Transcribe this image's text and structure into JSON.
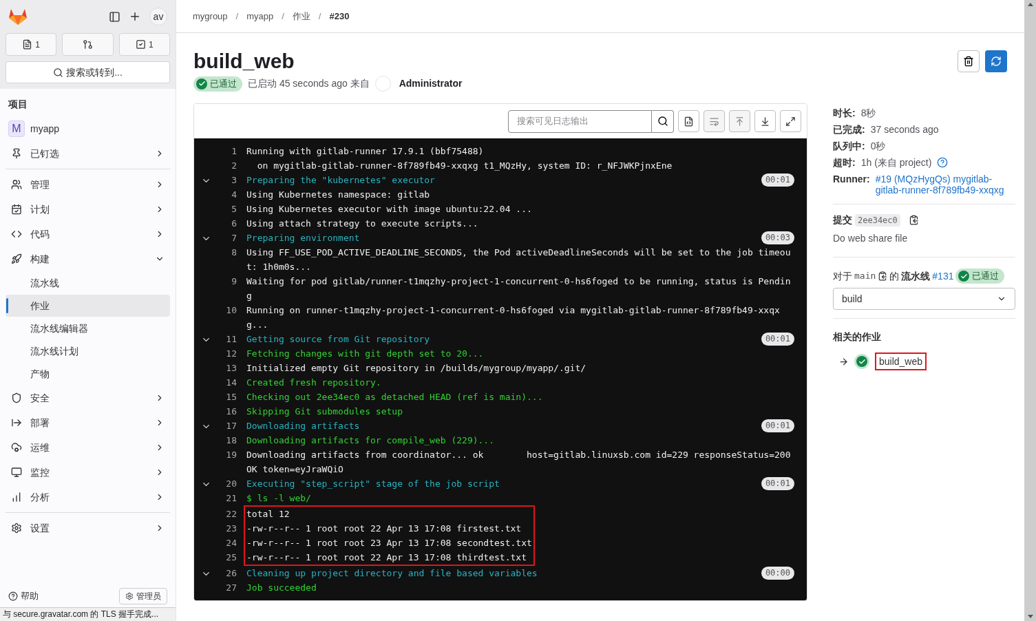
{
  "sidebar": {
    "avatar": "av",
    "top_buttons": [
      {
        "kind": "issues",
        "count": "1"
      },
      {
        "kind": "merge_requests"
      },
      {
        "kind": "todos",
        "count": "1"
      }
    ],
    "search": "搜索或转到...",
    "heading": "项目",
    "project": {
      "initial": "M",
      "name": "myapp"
    },
    "sections": [
      [
        {
          "label": "已钉选",
          "expanded": false
        }
      ],
      [
        {
          "label": "管理",
          "expanded": false
        },
        {
          "label": "计划",
          "expanded": false
        },
        {
          "label": "代码",
          "expanded": false
        },
        {
          "label": "构建",
          "expanded": true,
          "children": [
            {
              "label": "流水线",
              "selected": false
            },
            {
              "label": "作业",
              "selected": true
            },
            {
              "label": "流水线编辑器",
              "selected": false
            },
            {
              "label": "流水线计划",
              "selected": false
            },
            {
              "label": "产物",
              "selected": false
            }
          ]
        },
        {
          "label": "安全",
          "expanded": false
        },
        {
          "label": "部署",
          "expanded": false
        },
        {
          "label": "运维",
          "expanded": false
        },
        {
          "label": "监控",
          "expanded": false
        },
        {
          "label": "分析",
          "expanded": false
        }
      ],
      [
        {
          "label": "设置",
          "expanded": false
        }
      ]
    ],
    "footer": {
      "help": "帮助",
      "admin": "管理员"
    }
  },
  "status_bar": "与 secure.gravatar.com 的 TLS 握手完成...",
  "breadcrumb": {
    "separator": "/",
    "items": [
      "mygroup",
      "myapp",
      "作业",
      "#230"
    ]
  },
  "job": {
    "title": "build_web",
    "status": "已通过",
    "started": "已启动 45 seconds ago 来自",
    "user": "Administrator"
  },
  "log": {
    "search_placeholder": "搜索可见日志输出",
    "lines": [
      {
        "n": "1",
        "kind": "plain",
        "text": "Running with gitlab-runner 17.9.1 (bbf75488)"
      },
      {
        "n": "2",
        "kind": "plain",
        "text": "  on mygitlab-gitlab-runner-8f789fb49-xxqxg t1_MQzHy, system ID: r_NFJWKPjnxEne"
      },
      {
        "n": "3",
        "kind": "section",
        "text": "Preparing the \"kubernetes\" executor",
        "duration": "00:01"
      },
      {
        "n": "4",
        "kind": "plain",
        "text": "Using Kubernetes namespace: gitlab"
      },
      {
        "n": "5",
        "kind": "plain",
        "text": "Using Kubernetes executor with image ubuntu:22.04 ..."
      },
      {
        "n": "6",
        "kind": "plain",
        "text": "Using attach strategy to execute scripts..."
      },
      {
        "n": "7",
        "kind": "section",
        "text": "Preparing environment",
        "duration": "00:03"
      },
      {
        "n": "8",
        "kind": "plain",
        "text": "Using FF_USE_POD_ACTIVE_DEADLINE_SECONDS, the Pod activeDeadlineSeconds will be set to the job timeout: 1h0m0s..."
      },
      {
        "n": "9",
        "kind": "plain",
        "text": "Waiting for pod gitlab/runner-t1mqzhy-project-1-concurrent-0-hs6foged to be running, status is Pending"
      },
      {
        "n": "10",
        "kind": "plain",
        "text": "Running on runner-t1mqzhy-project-1-concurrent-0-hs6foged via mygitlab-gitlab-runner-8f789fb49-xxqxg..."
      },
      {
        "n": "11",
        "kind": "section",
        "text": "Getting source from Git repository",
        "duration": "00:01"
      },
      {
        "n": "12",
        "kind": "success",
        "text": "Fetching changes with git depth set to 20..."
      },
      {
        "n": "13",
        "kind": "plain",
        "text": "Initialized empty Git repository in /builds/mygroup/myapp/.git/"
      },
      {
        "n": "14",
        "kind": "success",
        "text": "Created fresh repository."
      },
      {
        "n": "15",
        "kind": "success",
        "text": "Checking out 2ee34ec0 as detached HEAD (ref is main)..."
      },
      {
        "n": "16",
        "kind": "success",
        "text": "Skipping Git submodules setup"
      },
      {
        "n": "17",
        "kind": "section",
        "text": "Downloading artifacts",
        "duration": "00:01"
      },
      {
        "n": "18",
        "kind": "success",
        "text": "Downloading artifacts for compile_web (229)..."
      },
      {
        "n": "19",
        "kind": "plain",
        "text": "Downloading artifacts from coordinator... ok        host=gitlab.linuxsb.com id=229 responseStatus=200 OK token=eyJraWQiO"
      },
      {
        "n": "20",
        "kind": "section",
        "text": "Executing \"step_script\" stage of the job script",
        "duration": "00:01"
      },
      {
        "n": "21",
        "kind": "success",
        "text": "$ ls -l web/"
      },
      {
        "n": "22",
        "kind": "plain",
        "text": "total 12",
        "highlighted": true
      },
      {
        "n": "23",
        "kind": "plain",
        "text": "-rw-r--r-- 1 root root 22 Apr 13 17:08 firstest.txt",
        "highlighted": true
      },
      {
        "n": "24",
        "kind": "plain",
        "text": "-rw-r--r-- 1 root root 23 Apr 13 17:08 secondtest.txt",
        "highlighted": true
      },
      {
        "n": "25",
        "kind": "plain",
        "text": "-rw-r--r-- 1 root root 22 Apr 13 17:08 thirdtest.txt",
        "highlighted": true
      },
      {
        "n": "26",
        "kind": "section",
        "text": "Cleaning up project directory and file based variables",
        "duration": "00:00"
      },
      {
        "n": "27",
        "kind": "success",
        "text": "Job succeeded"
      }
    ]
  },
  "details": {
    "rows": [
      {
        "label": "时长:",
        "value": "8秒"
      },
      {
        "label": "已完成:",
        "value": "37 seconds ago"
      },
      {
        "label": "队列中:",
        "value": "0秒"
      },
      {
        "label": "超时:",
        "value": "1h (来自 project)",
        "help": true
      },
      {
        "label": "Runner:",
        "value": "#19 (MQzHygQs) mygitlab-gitlab-runner-8f789fb49-xxqxg",
        "link": true
      }
    ],
    "commit": {
      "label": "提交",
      "sha": "2ee34ec0",
      "message": "Do web share file"
    },
    "pipeline": {
      "prefix": "对于",
      "ref": "main",
      "middle": "的",
      "label": "流水线",
      "id": "#131",
      "status": "已通过"
    },
    "stage": "build",
    "related_heading": "相关的作业",
    "related_jobs": [
      {
        "name": "build_web",
        "highlighted": true
      }
    ]
  }
}
